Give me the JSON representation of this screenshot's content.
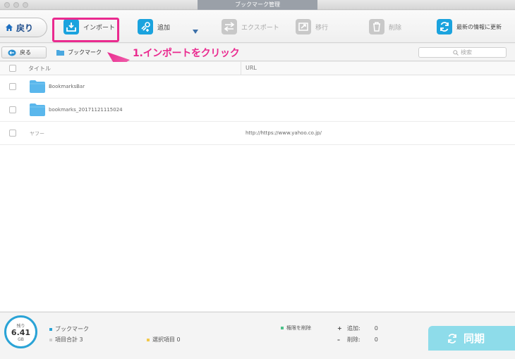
{
  "window": {
    "title": "ブックマーク管理"
  },
  "toolbar": {
    "back_label": "戻り",
    "import_label": "インポート",
    "add_label": "追加",
    "export_label": "エクスポート",
    "move_label": "移行",
    "delete_label": "削除",
    "refresh_label": "最新の情報に更新"
  },
  "annotation": {
    "text": "1.インポートをクリック",
    "color": "#ea2a8f"
  },
  "nav": {
    "back_label": "戻る",
    "breadcrumb": "ブックマーク",
    "search_placeholder": "検索"
  },
  "table": {
    "columns": [
      "タイトル",
      "URL"
    ],
    "rows": [
      {
        "title": "BookmarksBar",
        "url": "",
        "type": "folder"
      },
      {
        "title": "bookmarks_20171121115024",
        "url": "",
        "type": "folder"
      },
      {
        "title": "ヤフー",
        "url": "http://https://www.yahoo.co.jp/",
        "type": "link"
      }
    ]
  },
  "footer": {
    "storage_caption": "残り",
    "storage_value": "6.41",
    "storage_unit": "GB",
    "legend_bookmark": "ブックマーク",
    "total_label": "項目合計 3",
    "selected_label": "選択項目 0",
    "remove_perm_label": "権限を削除",
    "added_label": "追加:",
    "added_value": "0",
    "deleted_label": "削除:",
    "deleted_value": "0",
    "sync_label": "同期"
  },
  "colors": {
    "accent": "#1ba3de",
    "highlight": "#ea2a8f",
    "sync": "#8edcea"
  }
}
